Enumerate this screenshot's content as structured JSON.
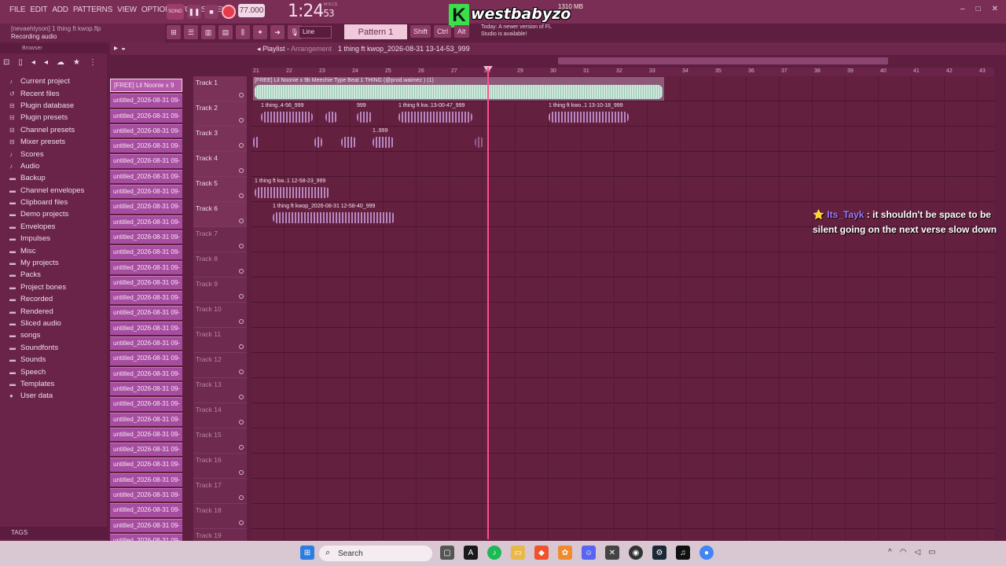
{
  "menu": [
    "FILE",
    "EDIT",
    "ADD",
    "PATTERNS",
    "VIEW",
    "OPTIONS",
    "TOOLS",
    "HELP"
  ],
  "hint": {
    "line1": "[nevaehtyson] 1 thing ft kwop.flp",
    "line2": "Recording audio"
  },
  "transport": {
    "mode": "SONG",
    "tempo": "77.000",
    "time_main": "1:24",
    "time_sub": "53",
    "time_label": "M:S:CS",
    "cpu": "1310 MB"
  },
  "overlay_logo": {
    "letter": "K",
    "text": "westbabyzo"
  },
  "toolbar2": {
    "line_mode": "Line",
    "pattern": "Pattern 1",
    "keys": [
      "Shift",
      "Ctrl",
      "Alt"
    ],
    "news": "Today: A newer version of FL Studio is available!"
  },
  "browser": {
    "title": "Browser",
    "items": [
      {
        "label": "Current project",
        "icon": "project-icon"
      },
      {
        "label": "Recent files",
        "icon": "recent-icon"
      },
      {
        "label": "Plugin database",
        "icon": "plugin-icon"
      },
      {
        "label": "Plugin presets",
        "icon": "preset-icon"
      },
      {
        "label": "Channel presets",
        "icon": "preset-icon"
      },
      {
        "label": "Mixer presets",
        "icon": "preset-icon"
      },
      {
        "label": "Scores",
        "icon": "note-icon"
      },
      {
        "label": "Audio",
        "icon": "audio-icon"
      },
      {
        "label": "Backup",
        "icon": "folder-icon"
      },
      {
        "label": "Channel envelopes",
        "icon": "folder-icon"
      },
      {
        "label": "Clipboard files",
        "icon": "folder-icon"
      },
      {
        "label": "Demo projects",
        "icon": "folder-icon"
      },
      {
        "label": "Envelopes",
        "icon": "folder-icon"
      },
      {
        "label": "Impulses",
        "icon": "folder-icon"
      },
      {
        "label": "Misc",
        "icon": "folder-icon"
      },
      {
        "label": "My projects",
        "icon": "folder-icon"
      },
      {
        "label": "Packs",
        "icon": "folder-icon"
      },
      {
        "label": "Project bones",
        "icon": "folder-icon"
      },
      {
        "label": "Recorded",
        "icon": "folder-icon"
      },
      {
        "label": "Rendered",
        "icon": "folder-icon"
      },
      {
        "label": "Sliced audio",
        "icon": "folder-icon"
      },
      {
        "label": "songs",
        "icon": "folder-icon"
      },
      {
        "label": "Soundfonts",
        "icon": "folder-icon"
      },
      {
        "label": "Sounds",
        "icon": "folder-icon"
      },
      {
        "label": "Speech",
        "icon": "folder-icon"
      },
      {
        "label": "Templates",
        "icon": "folder-icon"
      },
      {
        "label": "User data",
        "icon": "user-icon"
      }
    ],
    "tags_label": "TAGS"
  },
  "clips": [
    "[FREE] Lil Noonie x 9",
    "untitled_2026-08-31 09-",
    "untitled_2026-08-31 09-",
    "untitled_2026-08-31 09-",
    "untitled_2026-08-31 09-",
    "untitled_2026-08-31 09-",
    "untitled_2026-08-31 09-",
    "untitled_2026-08-31 09-",
    "untitled_2026-08-31 09-",
    "untitled_2026-08-31 09-",
    "untitled_2026-08-31 09-",
    "untitled_2026-08-31 09-",
    "untitled_2026-08-31 09-",
    "untitled_2026-08-31 09-",
    "untitled_2026-08-31 09-",
    "untitled_2026-08-31 09-",
    "untitled_2026-08-31 09-",
    "untitled_2026-08-31 09-",
    "untitled_2026-08-31 09-",
    "untitled_2026-08-31 09-",
    "untitled_2026-08-31 09-",
    "untitled_2026-08-31 09-",
    "untitled_2026-08-31 09-",
    "untitled_2026-08-31 09-",
    "untitled_2026-08-31 09-",
    "untitled_2026-08-31 09-",
    "untitled_2026-08-31 09-",
    "untitled_2026-08-31 09-",
    "untitled_2026-08-31 09-",
    "untitled_2026-08-31 09-",
    "untitled_2026-08-31 09-"
  ],
  "playlist": {
    "title": "Playlist",
    "subtitle": "Arrangement",
    "file": "1 thing ft kwop_2026-08-31 13-14-53_999"
  },
  "ruler": [
    "21",
    "22",
    "23",
    "24",
    "25",
    "26",
    "27",
    "28",
    "29",
    "30",
    "31",
    "32",
    "33",
    "34",
    "35",
    "36",
    "37",
    "38",
    "39",
    "40",
    "41",
    "42",
    "43"
  ],
  "tracks": [
    "Track 1",
    "Track 2",
    "Track 3",
    "Track 4",
    "Track 5",
    "Track 6",
    "Track 7",
    "Track 8",
    "Track 9",
    "Track 10",
    "Track 11",
    "Track 12",
    "Track 13",
    "Track 14",
    "Track 15",
    "Track 16",
    "Track 17",
    "Track 18",
    "Track 19"
  ],
  "regions": {
    "r1": "[FREE] Lil Noonie x 9b Meechie Type Beat 1 THING (@prod.waimez ) (1)",
    "r2a": "1 thing..4-56_999",
    "r2b": "999",
    "r2c": "1 thing ft kw..13-00-47_999",
    "r2d": "1 thing ft kwo..1 13-10-18_999",
    "r3a": "1..999",
    "r5": "1 thing ft kw..1 12-58-23_999",
    "r6": "1 thing ft kwop_2026-08-31 12-58-40_999"
  },
  "chat": {
    "user": "Its_Tayk",
    "message": "it shouldn't be space to be silent going on the next verse slow down"
  },
  "taskbar": {
    "search_placeholder": "Search"
  }
}
